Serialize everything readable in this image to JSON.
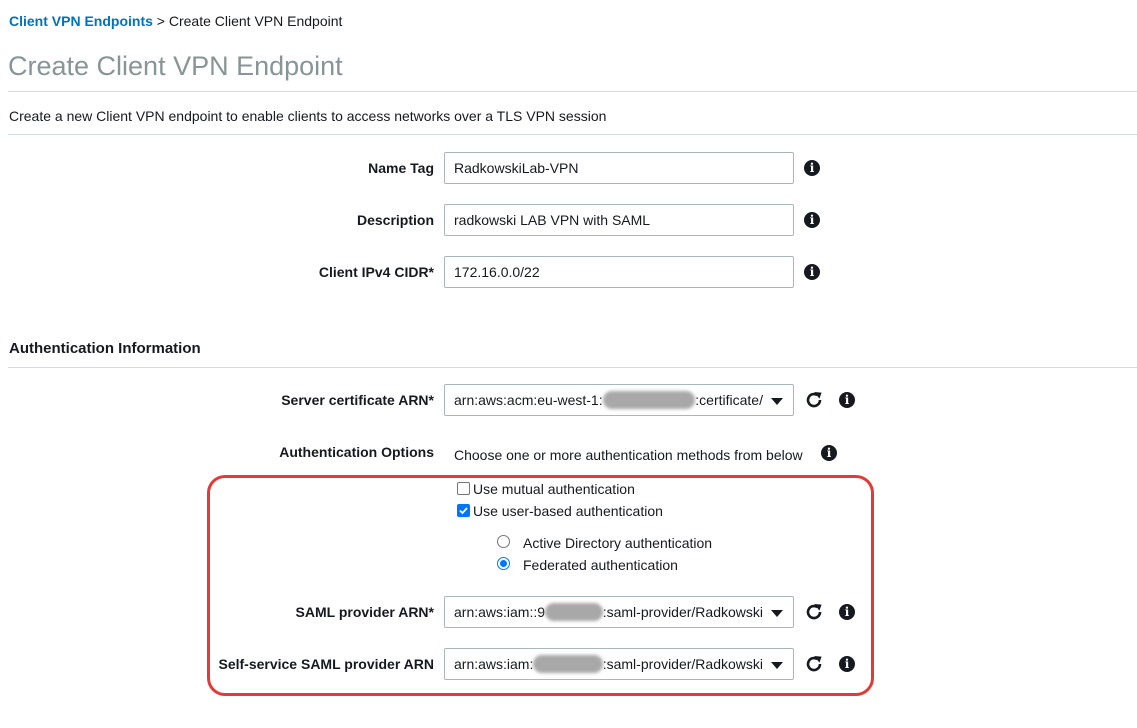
{
  "breadcrumb": {
    "parent": "Client VPN Endpoints",
    "separator": ">",
    "current": "Create Client VPN Endpoint"
  },
  "page": {
    "title": "Create Client VPN Endpoint",
    "subtitle": "Create a new Client VPN endpoint to enable clients to access networks over a TLS VPN session"
  },
  "fields": {
    "name_tag": {
      "label": "Name Tag",
      "value": "RadkowskiLab-VPN"
    },
    "description": {
      "label": "Description",
      "value": "radkowski LAB VPN with SAML"
    },
    "client_cidr": {
      "label": "Client IPv4 CIDR*",
      "value": "172.16.0.0/22"
    }
  },
  "auth": {
    "section_title": "Authentication Information",
    "server_cert": {
      "label": "Server certificate ARN*",
      "value_prefix": "arn:aws:acm:eu-west-1:",
      "value_suffix": ":certificate/"
    },
    "options": {
      "label": "Authentication Options",
      "hint": "Choose one or more authentication methods from below"
    },
    "mutual": {
      "label": "Use mutual authentication",
      "checked": false
    },
    "user_based": {
      "label": "Use user-based authentication",
      "checked": true
    },
    "active_directory": {
      "label": "Active Directory authentication",
      "selected": false
    },
    "federated": {
      "label": "Federated authentication",
      "selected": true
    },
    "saml_provider": {
      "label": "SAML provider ARN*",
      "value_prefix": "arn:aws:iam::9",
      "value_suffix": ":saml-provider/Radkowski"
    },
    "self_service_saml": {
      "label": "Self-service SAML provider ARN",
      "value_prefix": "arn:aws:iam:",
      "value_suffix": ":saml-provider/Radkowski"
    }
  },
  "icons": {
    "info": "info-icon",
    "refresh": "refresh-icon",
    "dropdown": "chevron-down-icon",
    "checkmark": "check-icon"
  },
  "colors": {
    "link": "#0073bb",
    "title_gray": "#879596",
    "highlight_red": "#e03b38",
    "check_blue": "#0075ff"
  }
}
